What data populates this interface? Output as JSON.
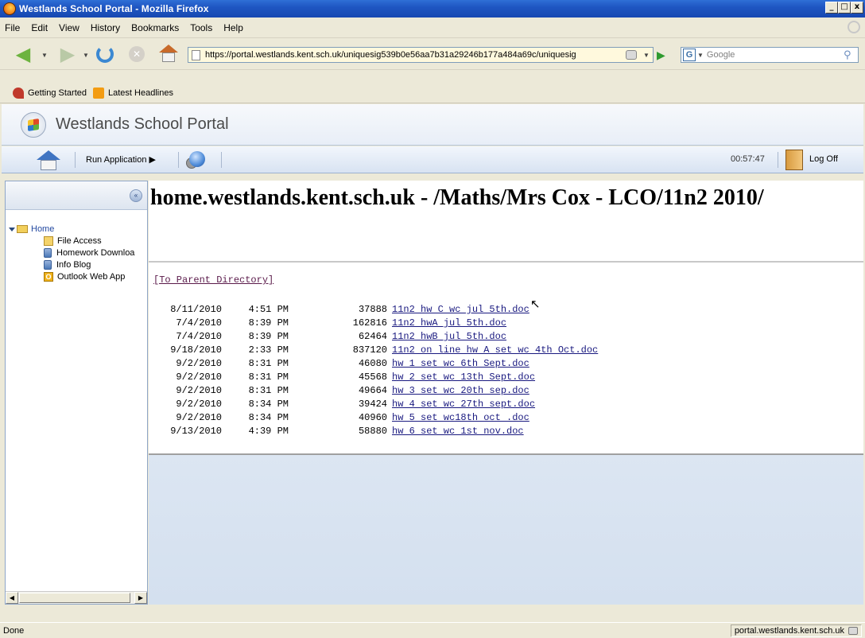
{
  "window": {
    "title": "Westlands School Portal - Mozilla Firefox",
    "min_glyph": "_",
    "max_glyph": "□",
    "close_glyph": "x"
  },
  "menu": [
    "File",
    "Edit",
    "View",
    "History",
    "Bookmarks",
    "Tools",
    "Help"
  ],
  "nav": {
    "url": "https://portal.westlands.kent.sch.uk/uniquesig539b0e56aa7b31a29246b177a484a69c/uniquesig",
    "search_placeholder": "Google",
    "search_engine_letter": "G"
  },
  "bookmarks": [
    "Getting Started",
    "Latest Headlines"
  ],
  "portal": {
    "title": "Westlands School Portal",
    "run_application": "Run Application",
    "time": "00:57:47",
    "logoff": "Log Off"
  },
  "sidebar": {
    "home": "Home",
    "items": [
      "File Access",
      "Homework Downloa",
      "Info Blog",
      "Outlook Web App"
    ]
  },
  "listing": {
    "heading": "home.westlands.kent.sch.uk - /Maths/Mrs Cox - LCO/11n2 2010/",
    "parent_link": "[To Parent Directory]",
    "files": [
      {
        "date": "8/11/2010",
        "time": "4:51 PM",
        "size": "37888",
        "name": "11n2 hw C wc jul 5th.doc"
      },
      {
        "date": "7/4/2010",
        "time": "8:39 PM",
        "size": "162816",
        "name": "11n2 hwA jul 5th.doc"
      },
      {
        "date": "7/4/2010",
        "time": "8:39 PM",
        "size": "62464",
        "name": "11n2 hwB jul 5th.doc"
      },
      {
        "date": "9/18/2010",
        "time": "2:33 PM",
        "size": "837120",
        "name": "11n2 on line hw A set wc 4th Oct.doc"
      },
      {
        "date": "9/2/2010",
        "time": "8:31 PM",
        "size": "46080",
        "name": "hw 1 set wc 6th Sept.doc"
      },
      {
        "date": "9/2/2010",
        "time": "8:31 PM",
        "size": "45568",
        "name": "hw 2 set wc 13th Sept.doc"
      },
      {
        "date": "9/2/2010",
        "time": "8:31 PM",
        "size": "49664",
        "name": "hw 3 set wc 20th sep.doc"
      },
      {
        "date": "9/2/2010",
        "time": "8:34 PM",
        "size": "39424",
        "name": "hw 4 set wc 27th sept.doc"
      },
      {
        "date": "9/2/2010",
        "time": "8:34 PM",
        "size": "40960",
        "name": "hw 5 set wc18th oct .doc"
      },
      {
        "date": "9/13/2010",
        "time": "4:39 PM",
        "size": "58880",
        "name": "hw 6 set wc 1st nov.doc"
      }
    ]
  },
  "status": {
    "left": "Done",
    "right": "portal.westlands.kent.sch.uk"
  }
}
